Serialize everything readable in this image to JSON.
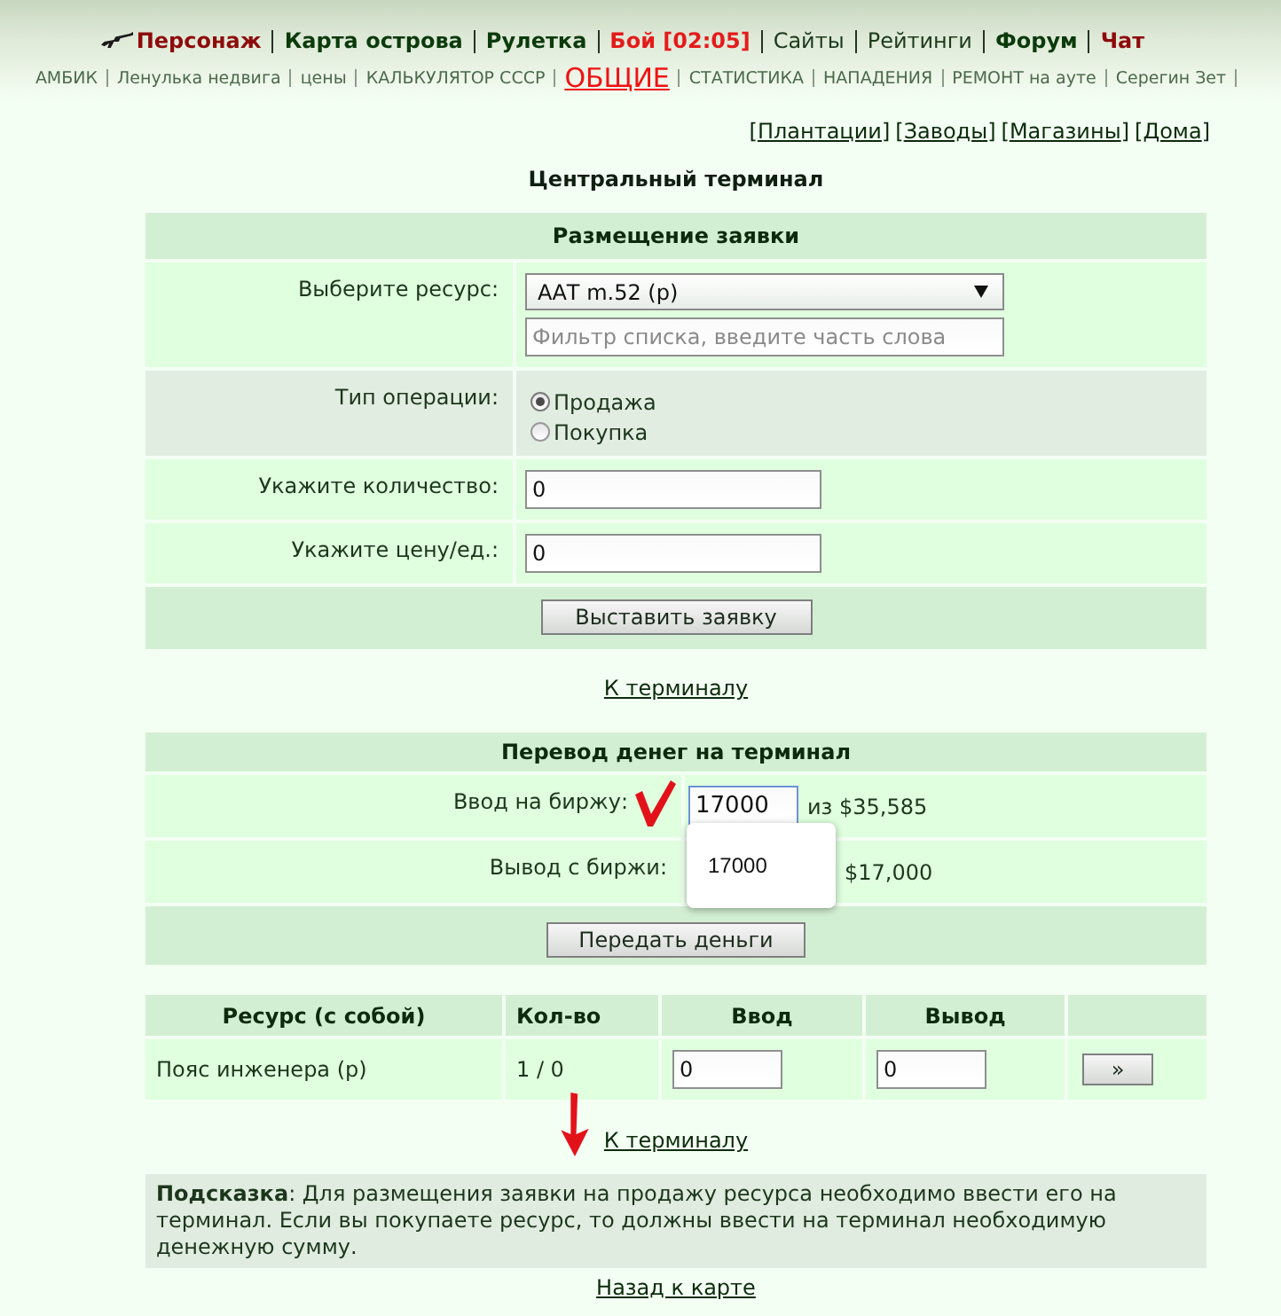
{
  "top_nav": {
    "primary": [
      {
        "label": "Персонаж",
        "kind": "accent"
      },
      {
        "label": "Карта острова",
        "kind": "main"
      },
      {
        "label": "Рулетка",
        "kind": "main"
      },
      {
        "label": "Бой [02:05]",
        "kind": "alert"
      },
      {
        "label": "Сайты",
        "kind": "regular"
      },
      {
        "label": "Рейтинги",
        "kind": "regular"
      },
      {
        "label": "Форум",
        "kind": "main"
      },
      {
        "label": "Чат",
        "kind": "accent"
      }
    ],
    "secondary": [
      {
        "label": "АМБИК",
        "kind": "regular"
      },
      {
        "label": "Ленулька недвига",
        "kind": "regular"
      },
      {
        "label": "цены",
        "kind": "regular"
      },
      {
        "label": "КАЛЬКУЛЯТОР СССР",
        "kind": "regular"
      },
      {
        "label": "ОБЩИЕ",
        "kind": "highlight"
      },
      {
        "label": "СТАТИСТИКА",
        "kind": "regular"
      },
      {
        "label": "НАПАДЕНИЯ",
        "kind": "regular"
      },
      {
        "label": "РЕМОНТ на ауте",
        "kind": "regular"
      },
      {
        "label": "Серегин Зет",
        "kind": "regular"
      }
    ]
  },
  "quick_links": {
    "bracket_open": "[",
    "bracket_close": "]",
    "items": [
      "Плантации",
      "Заводы",
      "Магазины",
      "Дома"
    ]
  },
  "page_title": "Центральный терминал",
  "order_form": {
    "title": "Размещение заявки",
    "resource_label": "Выберите ресурс:",
    "resource_value": "ААТ m.52 (р)",
    "filter_placeholder": "Фильтр списка, введите часть слова",
    "operation_label": "Тип операции:",
    "operations": [
      {
        "label": "Продажа",
        "selected": true
      },
      {
        "label": "Покупка",
        "selected": false
      }
    ],
    "quantity_label": "Укажите количество:",
    "quantity_value": "0",
    "price_label": "Укажите цену/ед.:",
    "price_value": "0",
    "submit": "Выставить заявку"
  },
  "terminal_link_1": "К терминалу",
  "money_transfer": {
    "title": "Перевод денег на терминал",
    "deposit_label": "Ввод на биржу:",
    "deposit_value": "17000",
    "deposit_focused": true,
    "deposit_note": "из $35,585",
    "withdraw_label": "Вывод с биржи:",
    "withdraw_note": "$17,000",
    "autocomplete": [
      "17000"
    ],
    "submit": "Передать деньги"
  },
  "resources_table": {
    "columns": [
      "Ресурс (с собой)",
      "Кол-во",
      "Ввод",
      "Вывод"
    ],
    "rows": [
      {
        "name": "Пояс инженера (р)",
        "quantity": "1 / 0",
        "deposit": "0",
        "withdraw": "0",
        "action": "»"
      }
    ]
  },
  "terminal_link_2": "К терминалу",
  "hint": "**Подсказка**: Для размещения заявки на продажу ресурса необходимо ввести его на терминал. Если вы покупаете ресурс, то должны ввести на терминал необходимую денежную сумму.",
  "back_link": "Назад к карте"
}
